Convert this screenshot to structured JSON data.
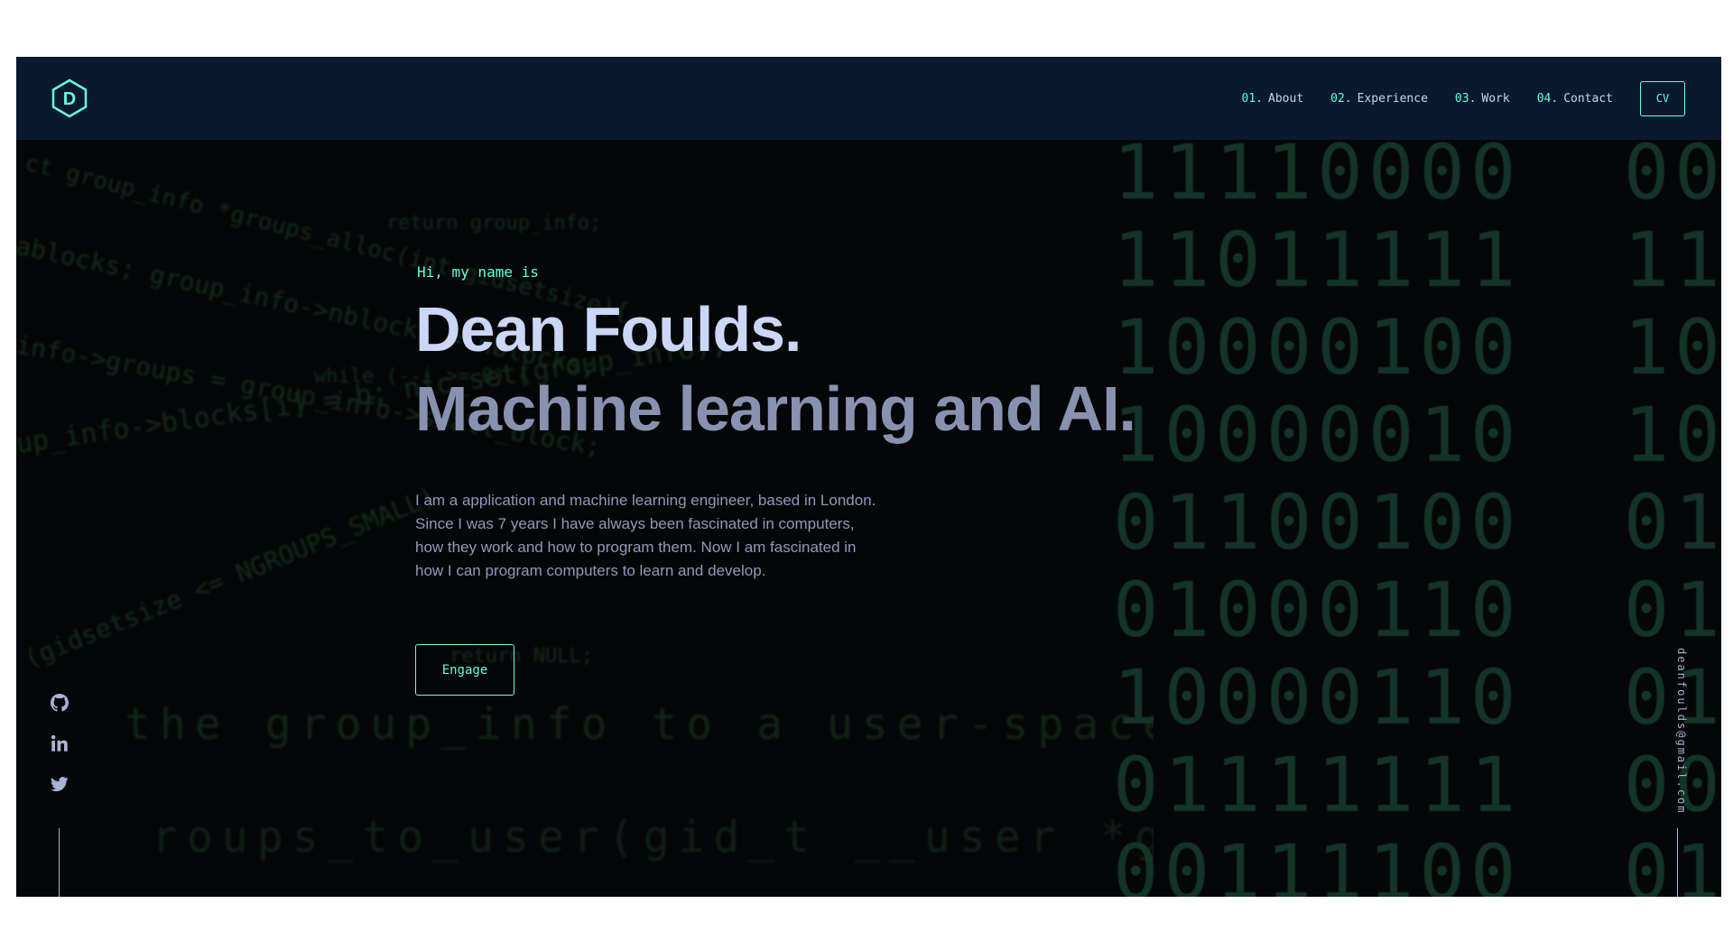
{
  "nav": {
    "logo_letter": "D",
    "links": [
      {
        "num": "01.",
        "label": "About"
      },
      {
        "num": "02.",
        "label": "Experience"
      },
      {
        "num": "03.",
        "label": "Work"
      },
      {
        "num": "04.",
        "label": "Contact"
      }
    ],
    "cv_label": "CV"
  },
  "hero": {
    "greeting": "Hi, my name is",
    "name": "Dean Foulds.",
    "tagline": "Machine learning and AI.",
    "intro": "I am a application and machine learning engineer, based in London. Since I was 7 years I have always been fascinated in computers, how they work and how to program them. Now I am fascinated in how I can program computers to learn and develop.",
    "cta_label": "Engage"
  },
  "social": {
    "icons": [
      "github-icon",
      "linkedin-icon",
      "twitter-icon"
    ]
  },
  "email": "deanfoulds@gmail.com",
  "colors": {
    "accent": "#64ffda",
    "nav_bg": "#0a1930",
    "heading": "#ccd6f6",
    "subheading": "#8892b0",
    "page_bg": "#050607"
  }
}
